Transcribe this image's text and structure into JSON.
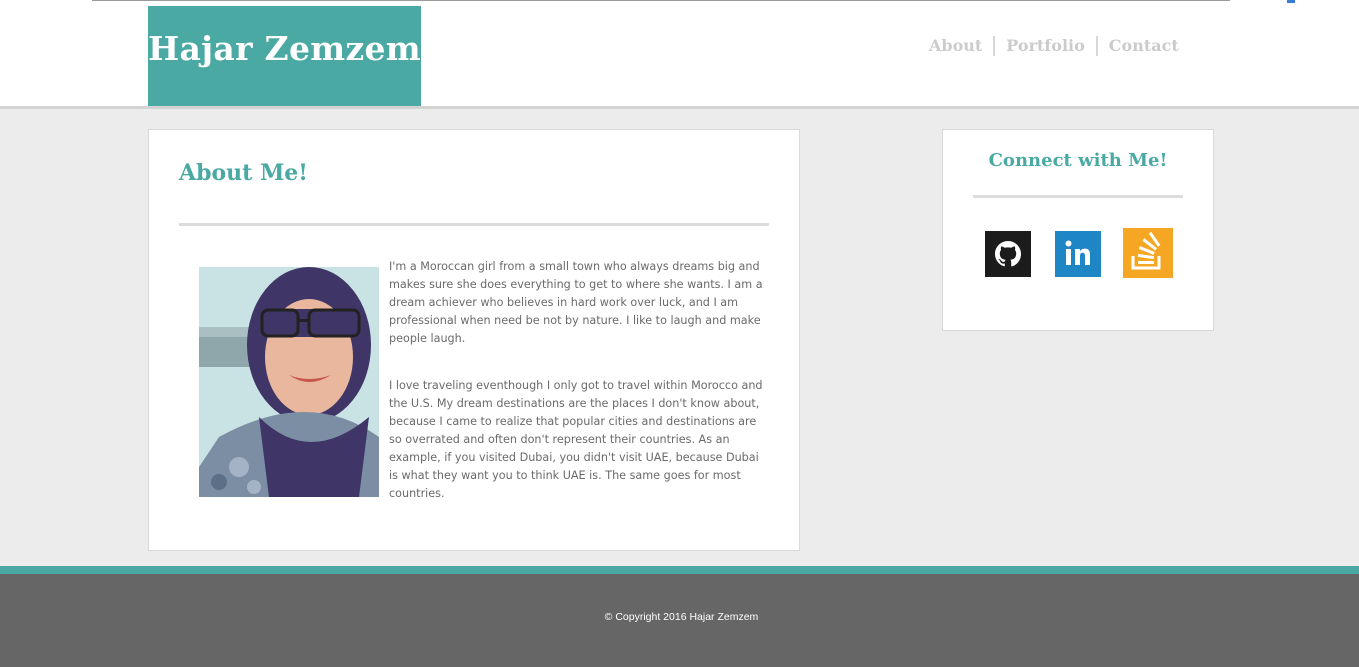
{
  "header": {
    "logo_text": "Hajar Zemzem",
    "nav": [
      "About",
      "Portfolio",
      "Contact"
    ]
  },
  "about": {
    "heading": "About Me!",
    "paragraphs": [
      "I'm a Moroccan girl from a small town who always dreams big and makes sure she does everything to get to where she wants. I am a dream achiever who believes in hard work over luck, and I am professional when need be not by nature. I like to laugh and make people laugh.",
      "I love traveling eventhough I only got to travel within Morocco and the U.S. My dream destinations are the places I don't know about, because I came to realize that popular cities and destinations are so overrated and often don't represent their countries. As an example, if you visited Dubai, you didn't visit UAE, because Dubai is what they want you to think UAE is. The same goes for most countries."
    ]
  },
  "connect": {
    "heading": "Connect with Me!",
    "links": [
      {
        "icon": "github-icon"
      },
      {
        "icon": "linkedin-icon"
      },
      {
        "icon": "stackoverflow-icon"
      }
    ]
  },
  "footer": {
    "copyright": "© Copyright 2016 Hajar Zemzem"
  },
  "colors": {
    "accent": "#4aa9a3",
    "footer": "#666666",
    "nav_text": "#cbcbcb"
  }
}
